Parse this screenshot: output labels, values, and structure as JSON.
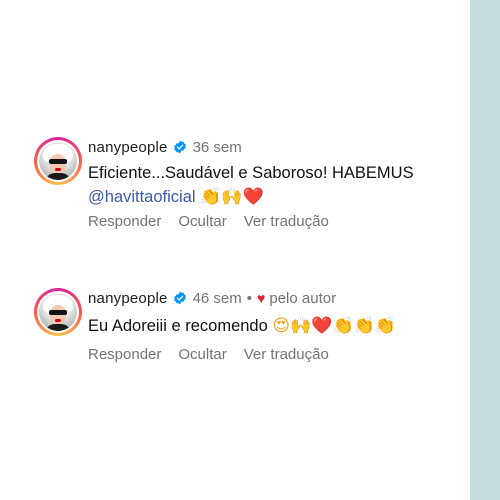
{
  "comments": [
    {
      "username": "nanypeople",
      "time": "36 sem",
      "line1": "Eficiente...Saudável e Saboroso! HABEMUS",
      "mention": "@havittaoficial",
      "emojis": [
        "👏",
        "🙌",
        "❤️"
      ],
      "actions": {
        "reply": "Responder",
        "hide": "Ocultar",
        "translate": "Ver tradução"
      }
    },
    {
      "username": "nanypeople",
      "time": "46 sem",
      "author_heart": "♥",
      "author_label": "pelo autor",
      "text": "Eu Adoreiii e recomendo",
      "emojis": [
        "😍",
        "🙌",
        "❤️",
        "👏",
        "👏",
        "👏"
      ],
      "actions": {
        "reply": "Responder",
        "hide": "Ocultar",
        "translate": "Ver tradução"
      }
    }
  ],
  "colors": {
    "side_strip": "#c5dcdf",
    "mention": "#3b5aa8",
    "verified": "#0095f6",
    "secondary_text": "#737373"
  }
}
